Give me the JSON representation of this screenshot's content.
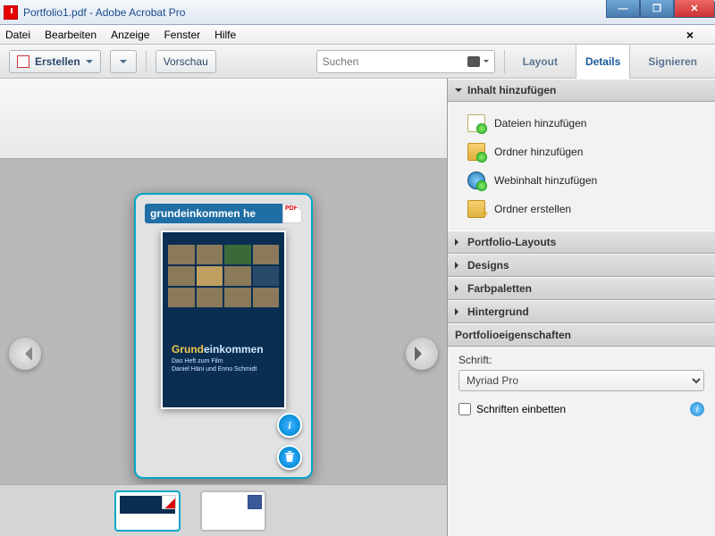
{
  "window": {
    "title": "Portfolio1.pdf - Adobe Acrobat Pro"
  },
  "menu": {
    "items": [
      "Datei",
      "Bearbeiten",
      "Anzeige",
      "Fenster",
      "Hilfe"
    ]
  },
  "toolbar": {
    "create": "Erstellen",
    "preview": "Vorschau",
    "search_placeholder": "Suchen",
    "layout": "Layout",
    "details": "Details",
    "sign": "Signieren"
  },
  "card": {
    "filename": "grundeinkommen he",
    "cover_title_a": "Grund",
    "cover_title_b": "einkommen",
    "cover_sub": "Das Heft zum Film\nDaniel Häni und Enno Schmidt"
  },
  "panel": {
    "add_header": "Inhalt hinzufügen",
    "add_items": [
      "Dateien hinzufügen",
      "Ordner hinzufügen",
      "Webinhalt hinzufügen",
      "Ordner erstellen"
    ],
    "sections": [
      "Portfolio-Layouts",
      "Designs",
      "Farbpaletten",
      "Hintergrund"
    ],
    "props_header": "Portfolioeigenschaften",
    "font_label": "Schrift:",
    "font_value": "Myriad Pro",
    "embed": "Schriften einbetten"
  }
}
